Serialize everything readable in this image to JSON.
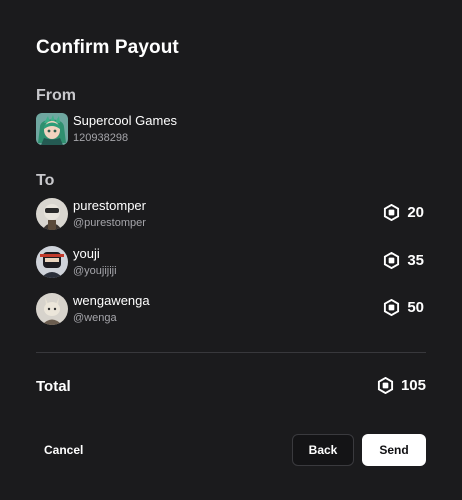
{
  "dialog": {
    "title": "Confirm Payout",
    "from_label": "From",
    "to_label": "To"
  },
  "from": {
    "name": "Supercool Games",
    "id": "120938298"
  },
  "recipients": [
    {
      "name": "purestomper",
      "handle": "@purestomper",
      "amount": "20"
    },
    {
      "name": "youji",
      "handle": "@youjijiji",
      "amount": "35"
    },
    {
      "name": "wengawenga",
      "handle": "@wenga",
      "amount": "50"
    }
  ],
  "total": {
    "label": "Total",
    "amount": "105"
  },
  "buttons": {
    "cancel": "Cancel",
    "back": "Back",
    "send": "Send"
  },
  "icons": {
    "currency": "robux-icon"
  },
  "colors": {
    "background": "#1b1b1d",
    "primary_button": "#ffffff",
    "muted_text": "#a5a5aa"
  }
}
